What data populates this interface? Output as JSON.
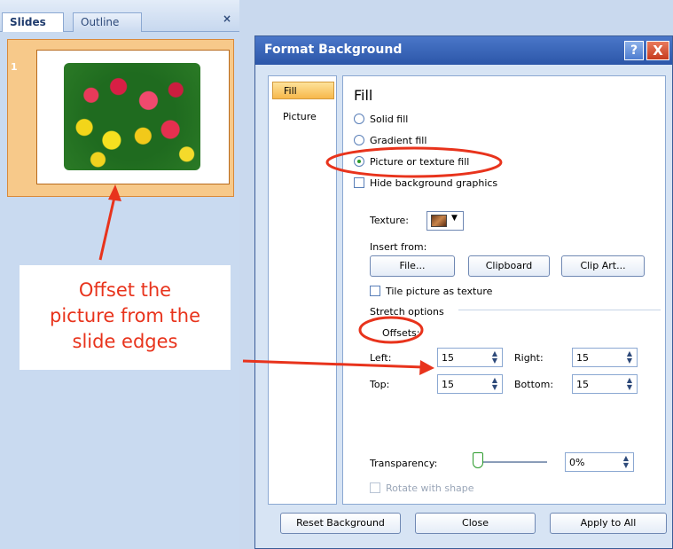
{
  "slides_pane": {
    "tabs": [
      "Slides",
      "Outline"
    ],
    "close_label": "×",
    "slide_number": "1"
  },
  "callout": {
    "lines": [
      "Offset the",
      "picture from the",
      "slide edges"
    ]
  },
  "dialog": {
    "title": "Format Background",
    "help_label": "?",
    "close_label": "X",
    "nav": [
      "Fill",
      "Picture"
    ],
    "heading": "Fill",
    "options": {
      "solid_fill": "Solid fill",
      "gradient_fill": "Gradient fill",
      "picture_fill": "Picture or texture fill",
      "hide_graphics": "Hide background graphics"
    },
    "selected_option": "picture_fill",
    "texture_label": "Texture:",
    "insert_from_label": "Insert from:",
    "buttons": {
      "file": "File...",
      "clipboard": "Clipboard",
      "clip_art": "Clip Art..."
    },
    "tile_label": "Tile picture as texture",
    "stretch_label": "Stretch options",
    "offsets_label": "Offsets:",
    "offsets": {
      "left_label": "Left:",
      "left_value": "15",
      "right_label": "Right:",
      "right_value": "15",
      "top_label": "Top:",
      "top_value": "15",
      "bottom_label": "Bottom:",
      "bottom_value": "15"
    },
    "transparency_label": "Transparency:",
    "transparency_value": "0%",
    "transparency_level": 0,
    "rotate_label": "Rotate with shape",
    "footer": {
      "reset": "Reset Background",
      "close": "Close",
      "apply": "Apply to All"
    }
  },
  "colors": {
    "annotation_red": "#e8331c",
    "accent_orange": "#f7b84b"
  }
}
